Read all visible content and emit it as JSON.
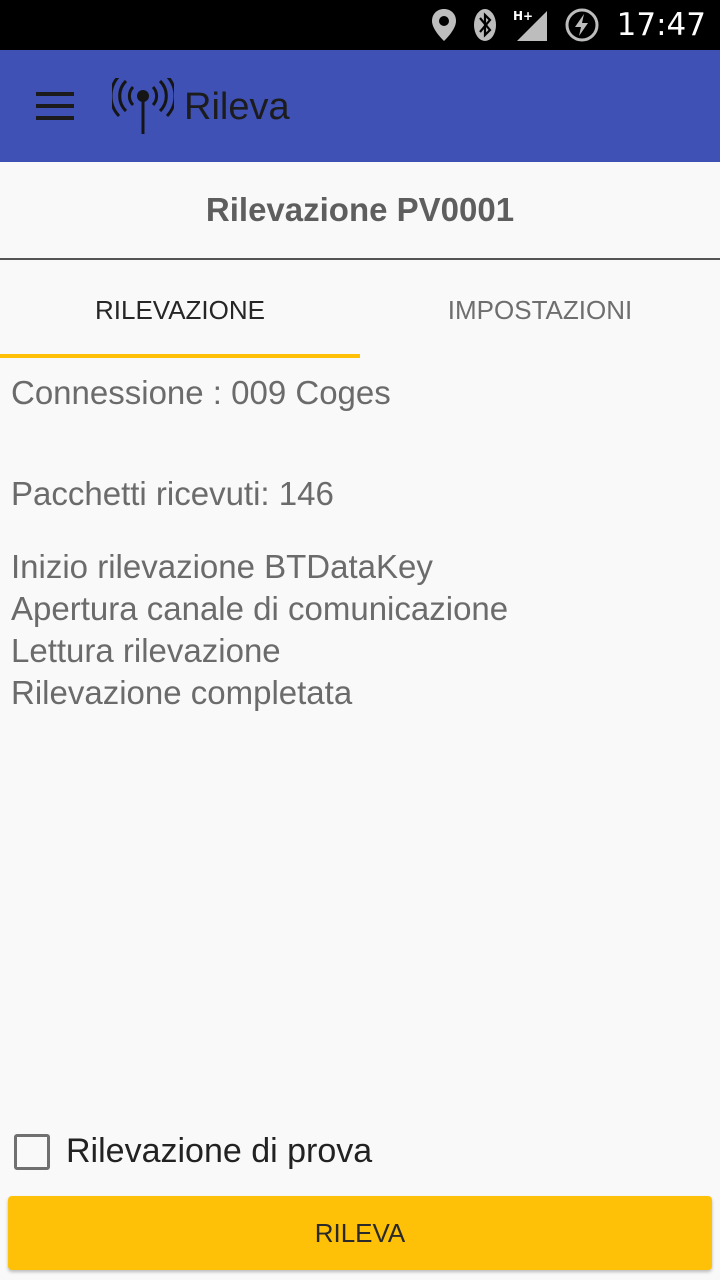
{
  "status_bar": {
    "time": "17:47",
    "icons": [
      "location-icon",
      "bluetooth-icon",
      "signal-h-plus-icon",
      "battery-charging-icon"
    ]
  },
  "app_bar": {
    "title": "Rileva",
    "color": "#3f51b5"
  },
  "page": {
    "title": "Rilevazione PV0001"
  },
  "tabs": [
    {
      "label": "RILEVAZIONE",
      "selected": true
    },
    {
      "label": "IMPOSTAZIONI",
      "selected": false
    }
  ],
  "content": {
    "connection": "Connessione : 009 Coges",
    "packets": "Pacchetti ricevuti: 146",
    "log": [
      "Inizio rilevazione BTDataKey",
      "Apertura canale di comunicazione",
      "Lettura rilevazione",
      "Rilevazione completata"
    ]
  },
  "test_checkbox": {
    "label": "Rilevazione di prova",
    "checked": false
  },
  "action_button": {
    "label": "RILEVA",
    "color": "#ffc107"
  }
}
